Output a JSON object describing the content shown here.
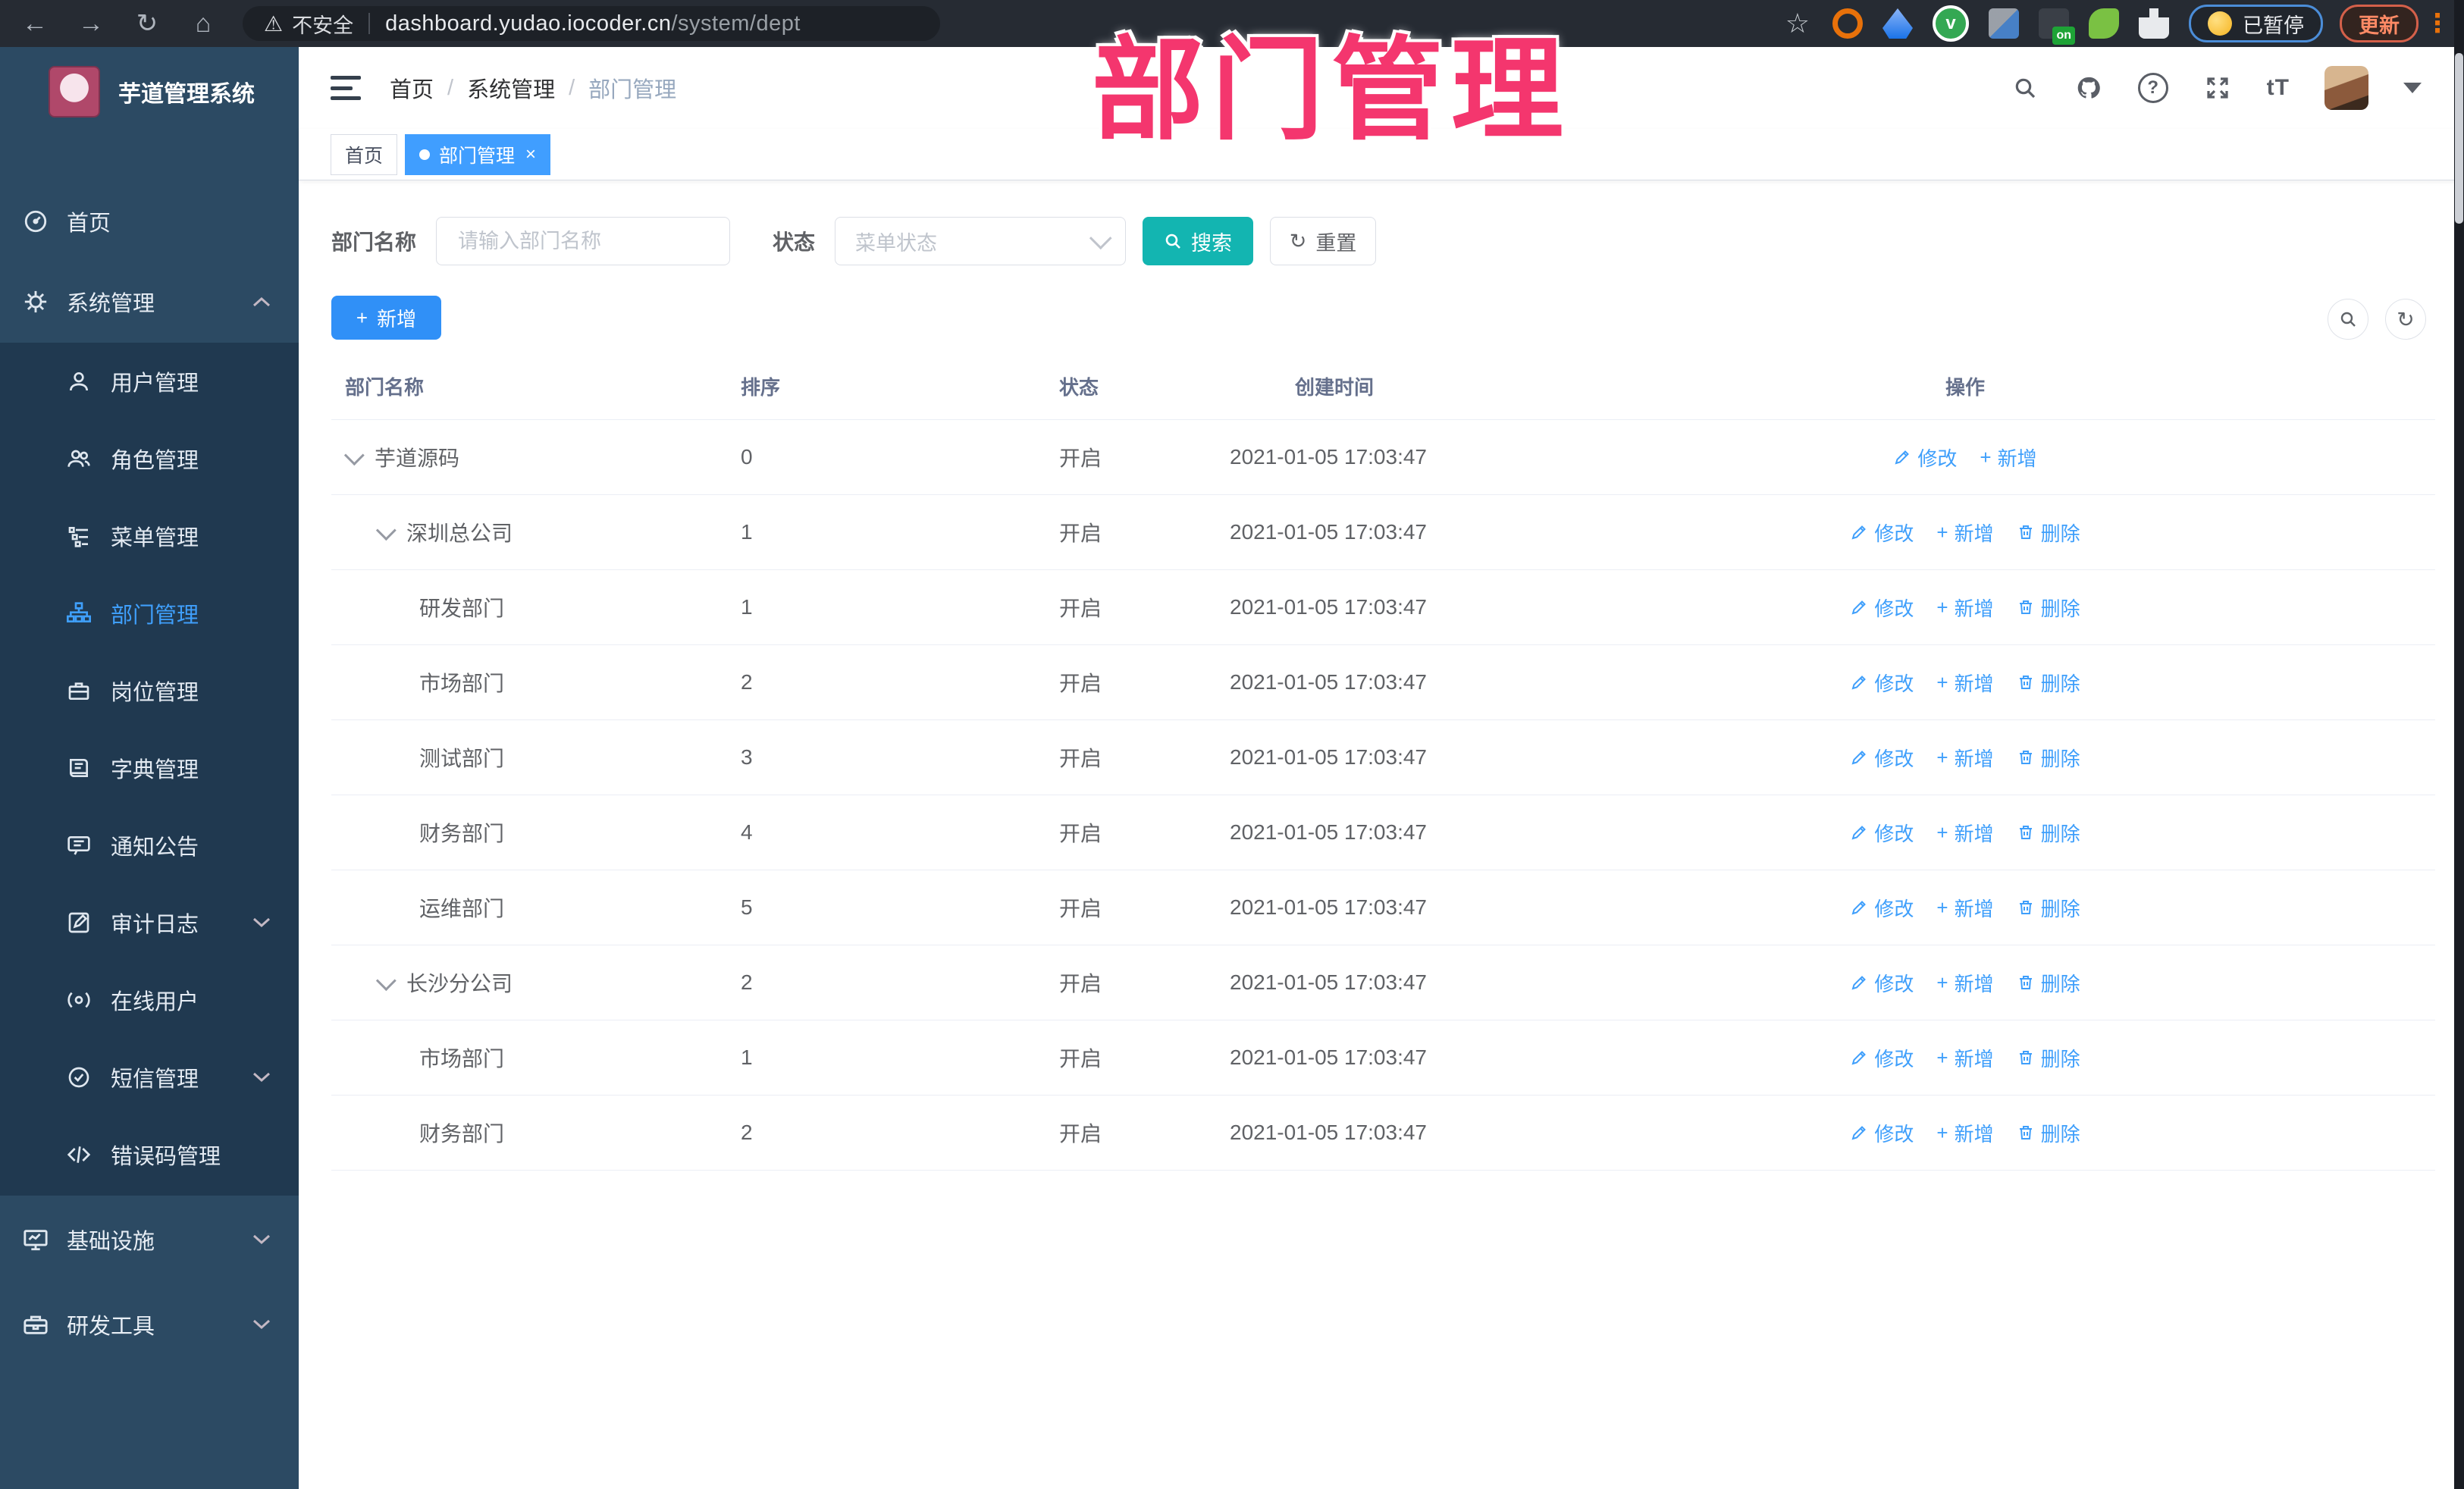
{
  "browser": {
    "security_label": "不安全",
    "url_host": "dashboard.yudao.iocoder.cn",
    "url_path": "/system/dept",
    "paused_chip": "已暂停",
    "update_button": "更新"
  },
  "overlay_title": "部门管理",
  "sidebar": {
    "app_title": "芋道管理系统",
    "home": "首页",
    "system": "系统管理",
    "sub": {
      "users": "用户管理",
      "roles": "角色管理",
      "menus": "菜单管理",
      "depts": "部门管理",
      "posts": "岗位管理",
      "dicts": "字典管理",
      "notices": "通知公告",
      "audit": "审计日志",
      "online": "在线用户",
      "sms": "短信管理",
      "errcodes": "错误码管理"
    },
    "infra": "基础设施",
    "devtools": "研发工具"
  },
  "header": {
    "breadcrumb": {
      "home": "首页",
      "system": "系统管理",
      "current": "部门管理"
    }
  },
  "tabs": {
    "home": "首页",
    "active": "部门管理",
    "close": "×"
  },
  "search": {
    "name_label": "部门名称",
    "name_placeholder": "请输入部门名称",
    "status_label": "状态",
    "status_placeholder": "菜单状态",
    "search_button": "搜索",
    "reset_button": "重置"
  },
  "toolbar": {
    "add_button": "新增"
  },
  "table": {
    "columns": {
      "name": "部门名称",
      "sort": "排序",
      "status": "状态",
      "created": "创建时间",
      "ops": "操作"
    },
    "ops": {
      "edit": "修改",
      "add": "新增",
      "delete": "删除"
    },
    "rows": [
      {
        "name": "芋道源码",
        "sort": "0",
        "status": "开启",
        "created": "2021-01-05 17:03:47"
      },
      {
        "name": "深圳总公司",
        "sort": "1",
        "status": "开启",
        "created": "2021-01-05 17:03:47"
      },
      {
        "name": "研发部门",
        "sort": "1",
        "status": "开启",
        "created": "2021-01-05 17:03:47"
      },
      {
        "name": "市场部门",
        "sort": "2",
        "status": "开启",
        "created": "2021-01-05 17:03:47"
      },
      {
        "name": "测试部门",
        "sort": "3",
        "status": "开启",
        "created": "2021-01-05 17:03:47"
      },
      {
        "name": "财务部门",
        "sort": "4",
        "status": "开启",
        "created": "2021-01-05 17:03:47"
      },
      {
        "name": "运维部门",
        "sort": "5",
        "status": "开启",
        "created": "2021-01-05 17:03:47"
      },
      {
        "name": "长沙分公司",
        "sort": "2",
        "status": "开启",
        "created": "2021-01-05 17:03:47"
      },
      {
        "name": "市场部门",
        "sort": "1",
        "status": "开启",
        "created": "2021-01-05 17:03:47"
      },
      {
        "name": "财务部门",
        "sort": "2",
        "status": "开启",
        "created": "2021-01-05 17:03:47"
      }
    ]
  }
}
